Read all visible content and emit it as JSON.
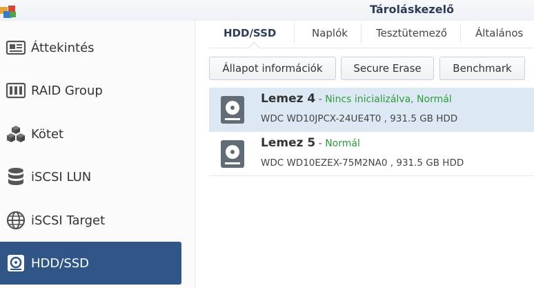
{
  "window": {
    "title": "Tároláskezelő",
    "icon": "app-icon"
  },
  "sidebar": {
    "items": [
      {
        "label": "Áttekintés",
        "icon": "overview-card-icon"
      },
      {
        "label": "RAID Group",
        "icon": "raid-group-icon"
      },
      {
        "label": "Kötet",
        "icon": "volume-cubes-icon"
      },
      {
        "label": "iSCSI LUN",
        "icon": "database-icon"
      },
      {
        "label": "iSCSI Target",
        "icon": "globe-icon"
      },
      {
        "label": "HDD/SSD",
        "icon": "hdd-icon",
        "active": true
      }
    ]
  },
  "tabs": [
    {
      "label": "HDD/SSD",
      "active": true
    },
    {
      "label": "Naplók"
    },
    {
      "label": "Tesztütemező"
    },
    {
      "label": "Általános"
    }
  ],
  "toolbar": {
    "status_info_label": "Állapot információk",
    "secure_erase_label": "Secure Erase",
    "benchmark_label": "Benchmark"
  },
  "disks": [
    {
      "name": "Lemez 4",
      "separator": " - ",
      "status": "Nincs inicializálva, Normál",
      "details": "WDC WD10JPCX-24UE4T0 , 931.5 GB HDD",
      "selected": true
    },
    {
      "name": "Lemez 5",
      "separator": " - ",
      "status": "Normál",
      "details": "WDC WD10EZEX-75M2NA0 , 931.5 GB HDD",
      "selected": false
    }
  ],
  "colors": {
    "accent": "#2f5687",
    "status_ok": "#2e9a3a",
    "selected_row": "#dde8f5"
  }
}
